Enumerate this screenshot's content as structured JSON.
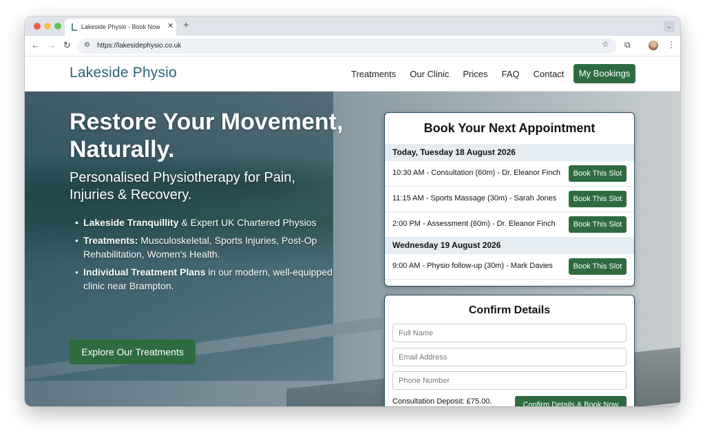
{
  "browser": {
    "tab_title": "Lakeside Physio - Book Now",
    "url": "https://lakesidephysio.co.uk"
  },
  "site": {
    "logo": "Lakeside Physio",
    "nav": [
      "Treatments",
      "Our Clinic",
      "Prices",
      "FAQ",
      "Contact"
    ],
    "bookings_label": "My Bookings"
  },
  "hero": {
    "title": "Restore Your Movement, Naturally.",
    "subtitle": "Personalised Physiotherapy for Pain, Injuries & Recovery.",
    "bullets": [
      {
        "bold": "Lakeside Tranquillity",
        "text": " & Expert UK Chartered Physios"
      },
      {
        "bold": "Treatments:",
        "text": " Musculoskeletal, Sports Injuries, Post-Op Rehabilitation, Women's Health."
      },
      {
        "bold": "Individual Treatment Plans",
        "text": " in our modern, well-equipped clinic near Brampton."
      }
    ],
    "cta_label": "Explore Our Treatments"
  },
  "appointments": {
    "title": "Book Your Next Appointment",
    "days": [
      {
        "label": "Today, Tuesday 18 August 2026",
        "slots": [
          {
            "text": "10:30 AM - Consultation (60m) - Dr. Eleanor Finch",
            "button": "Book This Slot"
          },
          {
            "text": "11:15 AM - Sports Massage (30m) - Sarah Jones",
            "button": "Book This Slot"
          },
          {
            "text": "2:00 PM - Assessment (60m) - Dr. Eleanor Finch",
            "button": "Book This Slot"
          }
        ]
      },
      {
        "label": "Wednesday 19 August 2026",
        "slots": [
          {
            "text": "9:00 AM - Physio follow-up (30m) - Mark Davies",
            "button": "Book This Slot"
          }
        ]
      }
    ]
  },
  "confirm": {
    "title": "Confirm Details",
    "full_name_placeholder": "Full Name",
    "email_placeholder": "Email Address",
    "phone_placeholder": "Phone Number",
    "deposit_text": "Consultation Deposit: £75.00.",
    "confirm_label": "Confirm Details & Book Now"
  },
  "colors": {
    "brand_green": "#2e6b3e",
    "logo_blue": "#2a6478"
  }
}
